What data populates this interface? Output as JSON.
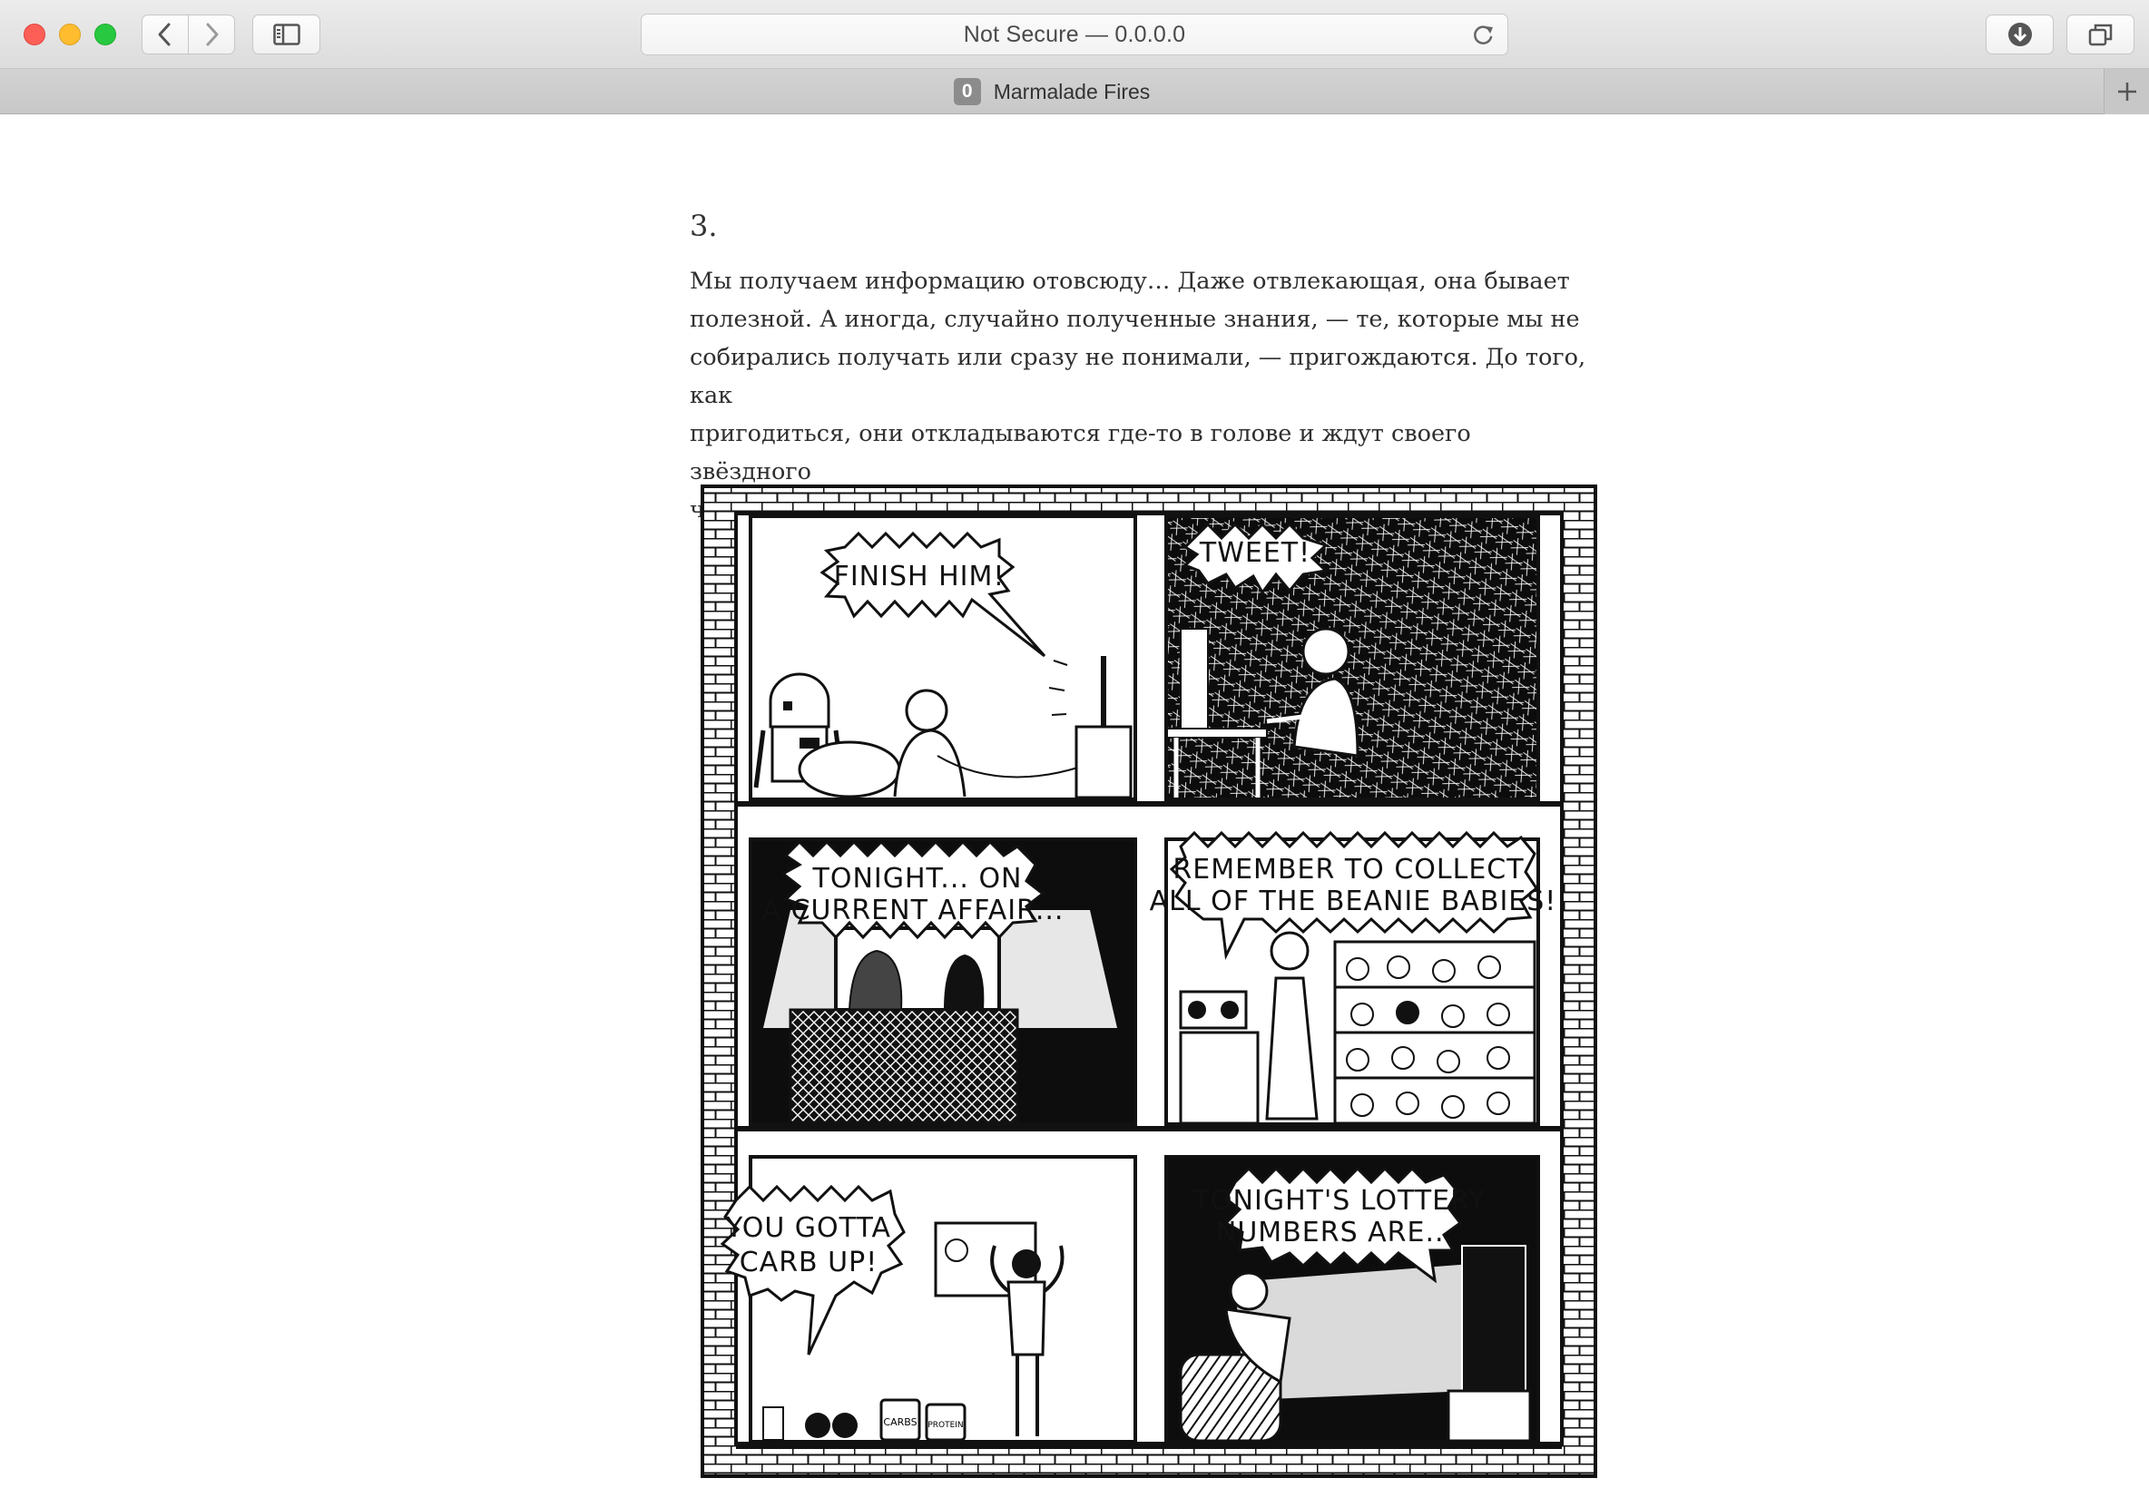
{
  "browser": {
    "address_text": "Not Secure — 0.0.0.0",
    "tab": {
      "favicon_letter": "0",
      "title": "Marmalade Fires"
    },
    "icons": {
      "back": "chevron-left-icon",
      "forward": "chevron-right-icon",
      "sidebar": "sidebar-icon",
      "reload": "reload-icon",
      "download": "download-icon",
      "tabs": "tab-overview-icon",
      "new_tab": "plus-icon"
    }
  },
  "article": {
    "section_number": "3.",
    "paragraph": "Мы получаем информацию отовсюду… Даже отвлекающая, она бывает\nполезной. А иногда, случайно полученные знания, — те, которые мы не\nсобирались получать или сразу не понимали, — пригождаются. До того, как\nпригодиться, они откладываются где-то в голове и ждут своего звёздного\nчаса."
  },
  "comic": {
    "panels": [
      {
        "speech": [
          "FINISH HIM!"
        ]
      },
      {
        "speech": [
          "TWEET!"
        ]
      },
      {
        "speech": [
          "TONIGHT... ON",
          "A CURRENT AFFAIR..."
        ]
      },
      {
        "speech": [
          "REMEMBER TO COLLECT",
          "ALL OF THE BEANIE BABIES!"
        ]
      },
      {
        "speech": [
          "YOU GOTTA",
          "CARB UP!"
        ]
      },
      {
        "speech": [
          "TONIGHT'S LOTTERY",
          "NUMBERS ARE..."
        ]
      }
    ],
    "jar_labels": [
      "CARBS",
      "PROTEIN"
    ]
  }
}
